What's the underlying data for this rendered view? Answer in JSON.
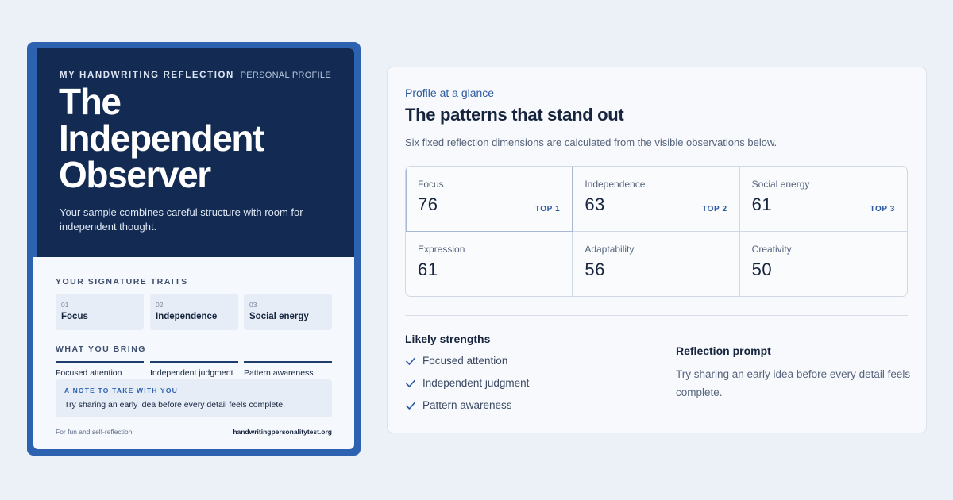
{
  "card": {
    "eyebrow": "MY HANDWRITING REFLECTION",
    "tag": "PERSONAL PROFILE",
    "title_lines": [
      "The",
      "Independent",
      "Observer"
    ],
    "subtitle": "Your sample combines careful structure with room for independent thought.",
    "traits_label": "YOUR SIGNATURE TRAITS",
    "traits": [
      {
        "num": "01",
        "name": "Focus"
      },
      {
        "num": "02",
        "name": "Independence"
      },
      {
        "num": "03",
        "name": "Social energy"
      }
    ],
    "bring_label": "WHAT YOU BRING",
    "bring": [
      "Focused attention",
      "Independent judgment",
      "Pattern awareness"
    ],
    "note_label": "A NOTE TO TAKE WITH YOU",
    "note_text": "Try sharing an early idea before every detail feels complete.",
    "footer_left": "For fun and self-reflection",
    "footer_right": "handwritingpersonalitytest.org"
  },
  "panel": {
    "eyebrow": "Profile at a glance",
    "title": "The patterns that stand out",
    "description": "Six fixed reflection dimensions are calculated from the visible observations below.",
    "dimensions": [
      {
        "name": "Focus",
        "score": "76",
        "rank": "TOP 1"
      },
      {
        "name": "Independence",
        "score": "63",
        "rank": "TOP 2"
      },
      {
        "name": "Social energy",
        "score": "61",
        "rank": "TOP 3"
      },
      {
        "name": "Expression",
        "score": "61",
        "rank": ""
      },
      {
        "name": "Adaptability",
        "score": "56",
        "rank": ""
      },
      {
        "name": "Creativity",
        "score": "50",
        "rank": ""
      }
    ],
    "strengths_title": "Likely strengths",
    "strengths": [
      "Focused attention",
      "Independent judgment",
      "Pattern awareness"
    ],
    "prompt_title": "Reflection prompt",
    "prompt_text": "Try sharing an early idea before every detail feels complete."
  },
  "colors": {
    "background": "#ecf1f8",
    "card_frame": "#2c62b0",
    "hero": "#132b52",
    "accent": "#2c5aa0"
  },
  "icons": {
    "strength_marker": "check-icon"
  }
}
